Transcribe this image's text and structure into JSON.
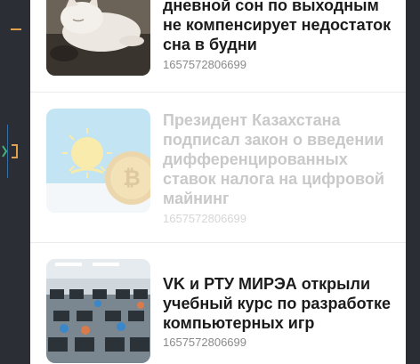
{
  "feed": {
    "items": [
      {
        "title": "дневной сон по выходным не компенсирует недостаток сна в будни",
        "timestamp": "1657572806699",
        "image": "sleeping-cat-photo"
      },
      {
        "title": "Президент Казахстана подписал закон о введении дифференцированных ставок налога на цифровой майнинг",
        "timestamp": "1657572806699",
        "image": "kazakhstan-flag-bitcoin-photo"
      },
      {
        "title": "VK и РТУ МИРЭА открыли учебный курс по разработке компьютерных игр",
        "timestamp": "1657572806699",
        "image": "computer-lab-photo"
      }
    ]
  },
  "colors": {
    "panel_bg": "#ffffff",
    "title_text": "#1b1b1b",
    "timestamp_text": "#8a8a8a",
    "faded_text": "#c9c9c9",
    "editor_bg": "#2b2e35",
    "editor_accent": "#e2a04a"
  }
}
